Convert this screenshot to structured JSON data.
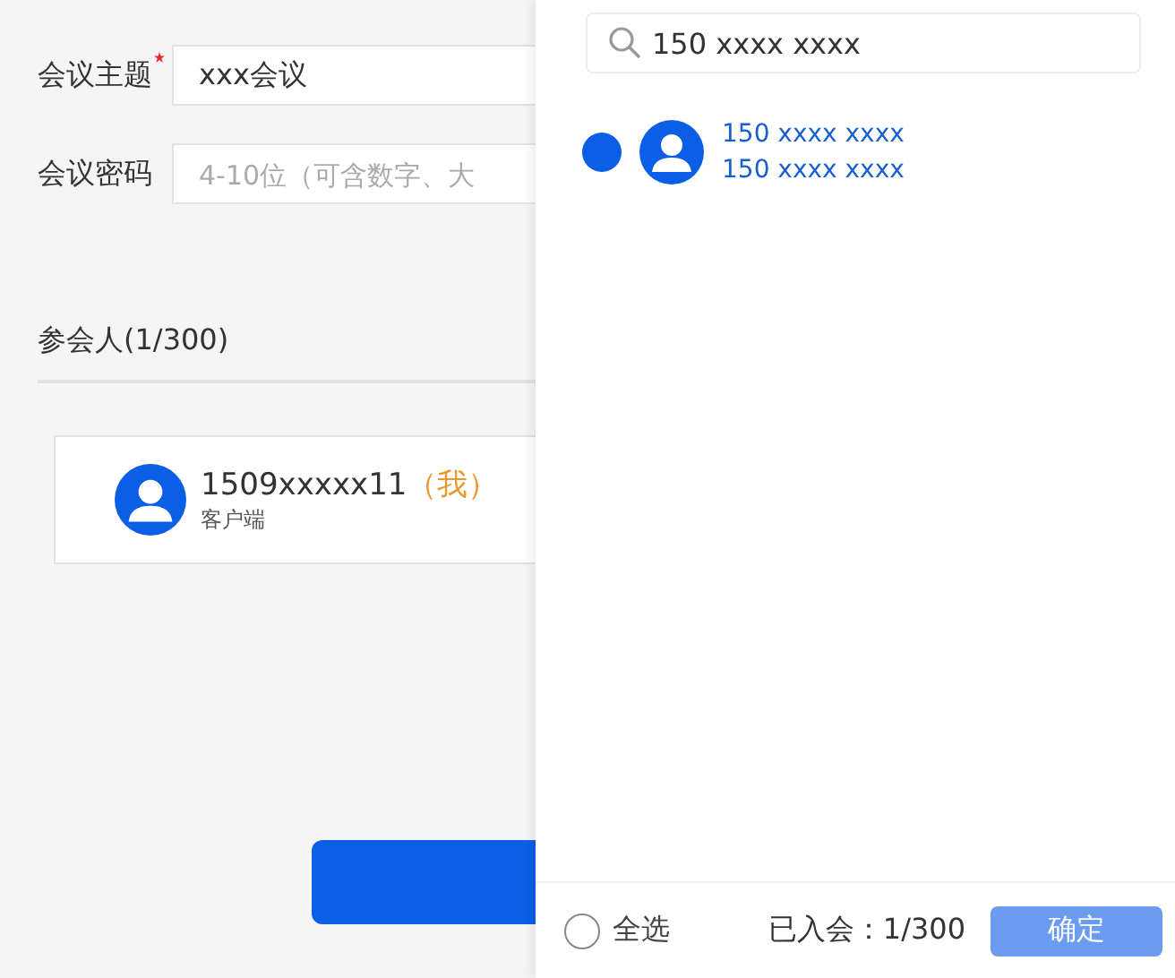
{
  "form": {
    "fields": [
      {
        "label": "会议主题",
        "required": true,
        "value": "xxx会议"
      },
      {
        "label": "会议密码",
        "required": false,
        "placeholder": "4-10位（可含数字、大"
      }
    ],
    "participants_title": "参会人(1/300)",
    "participants": [
      {
        "name": "1509xxxxx11",
        "tag": "（我）",
        "subtitle": "客户端"
      }
    ]
  },
  "drawer": {
    "search": {
      "value": "150 xxxx xxxx"
    },
    "results": [
      {
        "title": "150 xxxx xxxx",
        "subtitle": "150 xxxx xxxx",
        "selected": true
      }
    ],
    "select_all": {
      "label": "全选",
      "checked": false
    },
    "joined": "已入会：1/300",
    "confirm": "确定"
  }
}
